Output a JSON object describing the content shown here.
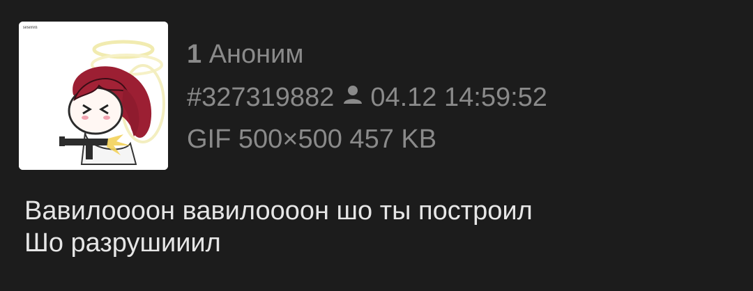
{
  "post": {
    "index": "1",
    "author": "Аноним",
    "post_id": "#327319882",
    "datetime": "04.12 14:59:52",
    "file_info": "GIF 500×500 457 KB",
    "thumbnail_signature": "seseren",
    "message_line1": "Вавилоооон вавилоооон шо ты построил",
    "message_line2": "Шо разрушииил"
  },
  "icons": {
    "user": "user-icon"
  },
  "colors": {
    "background": "#1c1c1c",
    "meta_text": "#8a8a8a",
    "body_text": "#e6e6e6",
    "thumbnail_bg": "#ffffff"
  }
}
